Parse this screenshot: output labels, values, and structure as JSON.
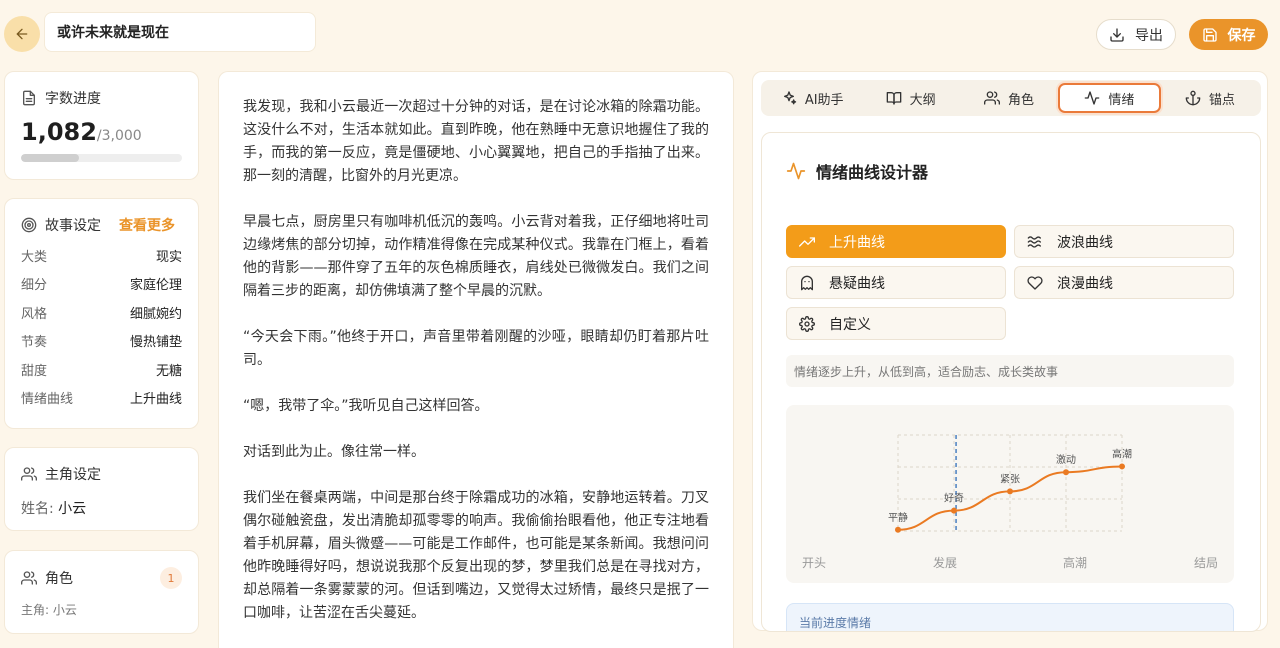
{
  "header": {
    "title": "或许未来就是现在",
    "export_label": "导出",
    "save_label": "保存"
  },
  "progress": {
    "title": "字数进度",
    "count": "1,082",
    "total": "/3,000",
    "fraction": 0.36
  },
  "story": {
    "title": "故事设定",
    "more": "查看更多",
    "items": [
      {
        "k": "大类",
        "v": "现实"
      },
      {
        "k": "细分",
        "v": "家庭伦理"
      },
      {
        "k": "风格",
        "v": "细腻婉约"
      },
      {
        "k": "节奏",
        "v": "慢热铺垫"
      },
      {
        "k": "甜度",
        "v": "无糖"
      },
      {
        "k": "情绪曲线",
        "v": "上升曲线"
      }
    ]
  },
  "protagonist": {
    "title": "主角设定",
    "label": "姓名:",
    "name": "小云"
  },
  "roles": {
    "title": "角色",
    "count": "1",
    "sub": "主角: 小云"
  },
  "editor": {
    "paragraphs": [
      "我发现，我和小云最近一次超过十分钟的对话，是在讨论冰箱的除霜功能。这没什么不对，生活本就如此。直到昨晚，他在熟睡中无意识地握住了我的手，而我的第一反应，竟是僵硬地、小心翼翼地，把自己的手指抽了出来。那一刻的清醒，比窗外的月光更凉。",
      "早晨七点，厨房里只有咖啡机低沉的轰鸣。小云背对着我，正仔细地将吐司边缘烤焦的部分切掉，动作精准得像在完成某种仪式。我靠在门框上，看着他的背影——那件穿了五年的灰色棉质睡衣，肩线处已微微发白。我们之间隔着三步的距离，却仿佛填满了整个早晨的沉默。",
      "“今天会下雨。”他终于开口，声音里带着刚醒的沙哑，眼睛却仍盯着那片吐司。",
      "“嗯，我带了伞。”我听见自己这样回答。",
      "对话到此为止。像往常一样。",
      "我们坐在餐桌两端，中间是那台终于除霜成功的冰箱，安静地运转着。刀叉偶尔碰触瓷盘，发出清脆却孤零零的响声。我偷偷抬眼看他，他正专注地看着手机屏幕，眉头微蹙——可能是工作邮件，也可能是某条新闻。我想问问他昨晚睡得好吗，想说说我那个反复出现的梦，梦里我们总是在寻找对方，却总隔着一条雾蒙蒙的河。但话到嘴边，又觉得太过矫情，最终只是抿了一口咖啡，让苦涩在舌尖蔓延。"
    ]
  },
  "tabs": [
    {
      "label": "AI助手",
      "icon": "sparkles-icon"
    },
    {
      "label": "大纲",
      "icon": "book-icon"
    },
    {
      "label": "角色",
      "icon": "users-icon"
    },
    {
      "label": "情绪",
      "icon": "activity-icon"
    },
    {
      "label": "锚点",
      "icon": "anchor-icon"
    }
  ],
  "designer": {
    "title": "情绪曲线设计器",
    "curves": [
      {
        "label": "上升曲线",
        "icon": "trending-up-icon"
      },
      {
        "label": "波浪曲线",
        "icon": "waves-icon"
      },
      {
        "label": "悬疑曲线",
        "icon": "ghost-icon"
      },
      {
        "label": "浪漫曲线",
        "icon": "heart-icon"
      },
      {
        "label": "自定义",
        "icon": "settings-icon"
      }
    ],
    "description": "情绪逐步上升，从低到高，适合励志、成长类故事",
    "current_label": "当前进度情绪",
    "accent": "#f39c19"
  },
  "chart_data": {
    "type": "line",
    "x": [
      0,
      1,
      2,
      3,
      4
    ],
    "values": [
      1,
      2,
      3,
      4,
      4.3
    ],
    "point_labels": [
      "平静",
      "好奇",
      "紧张",
      "激动",
      "高潮"
    ],
    "stage_labels": [
      "开头",
      "发展",
      "高潮",
      "结局"
    ],
    "current_progress": 0.36,
    "ylim": [
      0,
      5
    ],
    "line_color": "#ea7a22",
    "grid": true
  }
}
